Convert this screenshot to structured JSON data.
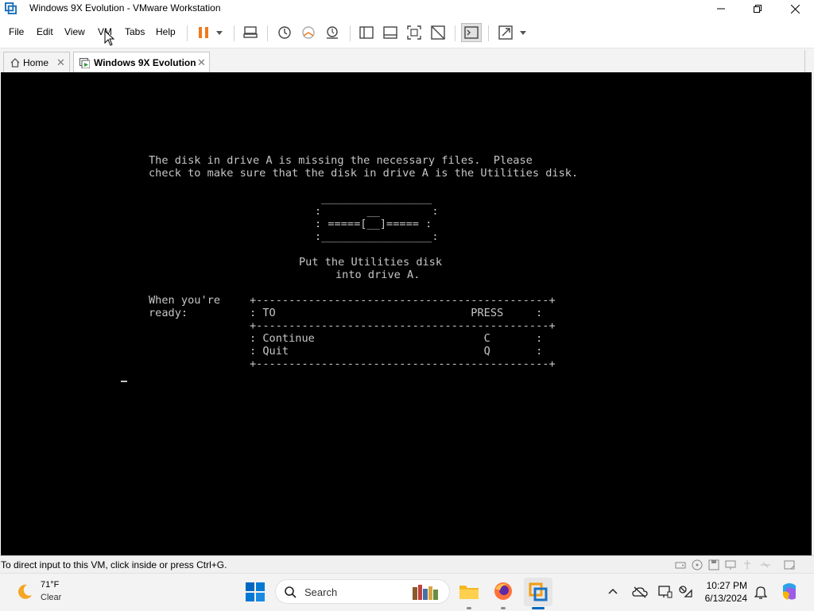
{
  "window": {
    "title": "Windows 9X Evolution - VMware Workstation"
  },
  "menu": {
    "items": [
      {
        "label": "File"
      },
      {
        "label": "Edit"
      },
      {
        "label": "View"
      },
      {
        "label": "VM"
      },
      {
        "label": "Tabs"
      },
      {
        "label": "Help"
      }
    ]
  },
  "toolbar": {
    "buttons": [
      "pause-icon",
      "dropdown-icon",
      "send-ctrl-alt-del-icon",
      "snapshot-icon",
      "revert-snapshot-icon",
      "snapshot-manager-icon",
      "library-icon",
      "thumbnail-icon",
      "full-screen-icon",
      "unity-icon",
      "console-view-icon",
      "stretch-icon",
      "dropdown-icon"
    ]
  },
  "tabs": [
    {
      "label": "Home",
      "active": false
    },
    {
      "label": "Windows 9X Evolution",
      "active": true
    }
  ],
  "vm_screen": {
    "message_line1": "The disk in drive A is missing the necessary files.  Please",
    "message_line2": "check to make sure that the disk in drive A is the Utilities disk.",
    "disk_art": [
      " _________________",
      ":       __        :",
      ": =====[__]===== :",
      ":_________________:"
    ],
    "prompt_line1": "Put the Utilities disk",
    "prompt_line2": "into drive A.",
    "ready_line1": "When you're",
    "ready_line2": "ready:",
    "table_border": "+---------------------------------------------+",
    "table_header": ": TO                              PRESS     :",
    "table_rows": [
      ": Continue                          C       :",
      ": Quit                              Q       :"
    ]
  },
  "status_bar": {
    "text": "To direct input to this VM, click inside or press Ctrl+G."
  },
  "taskbar": {
    "weather_temp": "71°F",
    "weather_condition": "Clear",
    "search_placeholder": "Search",
    "time": "10:27 PM",
    "date": "6/13/2024"
  },
  "colors": {
    "pause_accent": "#f07a1e",
    "vm_background": "#000000",
    "dos_text": "#c6c6c6",
    "windows_blue": "#0067c0"
  }
}
